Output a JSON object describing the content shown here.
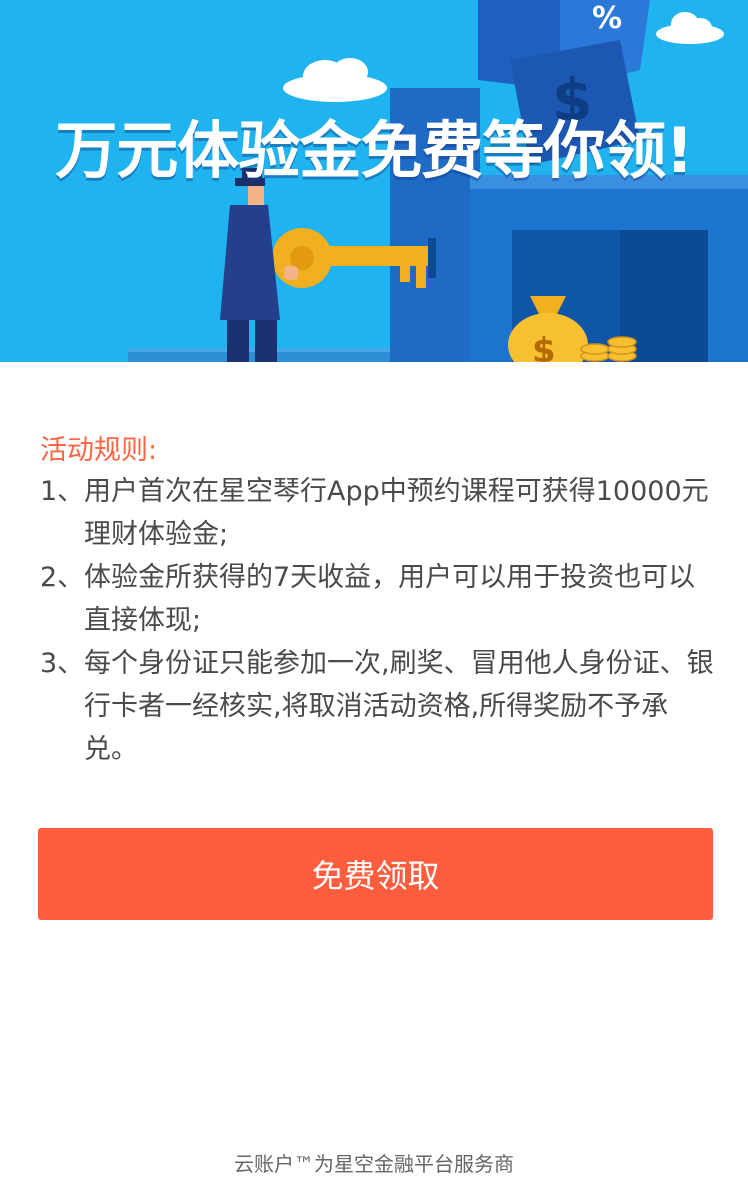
{
  "banner": {
    "title": "万元体验金免费等你领!"
  },
  "rules": {
    "heading": "活动规则:",
    "items": [
      {
        "num": "1、",
        "text": "用户首次在星空琴行App中预约课程可获得10000元理财体验金;"
      },
      {
        "num": "2、",
        "text": "体验金所获得的7天收益，用户可以用于投资也可以直接体现;"
      },
      {
        "num": "3、",
        "text": "每个身份证只能参加一次,刷奖、冒用他人身份证、银行卡者一经核实,将取消活动资格,所得奖励不予承兑。"
      }
    ]
  },
  "cta": {
    "label": "免费领取"
  },
  "footer": {
    "text": "云账户™为星空金融平台服务商"
  },
  "colors": {
    "banner_bg": "#1fb4f0",
    "accent": "#ff5d3e",
    "heading": "#ff6440",
    "body_text": "#4a4a4a",
    "footer_text": "#666666"
  },
  "icons": [
    "cloud-icon",
    "man-in-hat-illustration",
    "key-icon",
    "safe-box-illustration",
    "money-bag-icon",
    "coin-stack-icon",
    "dollar-dice-icon"
  ]
}
